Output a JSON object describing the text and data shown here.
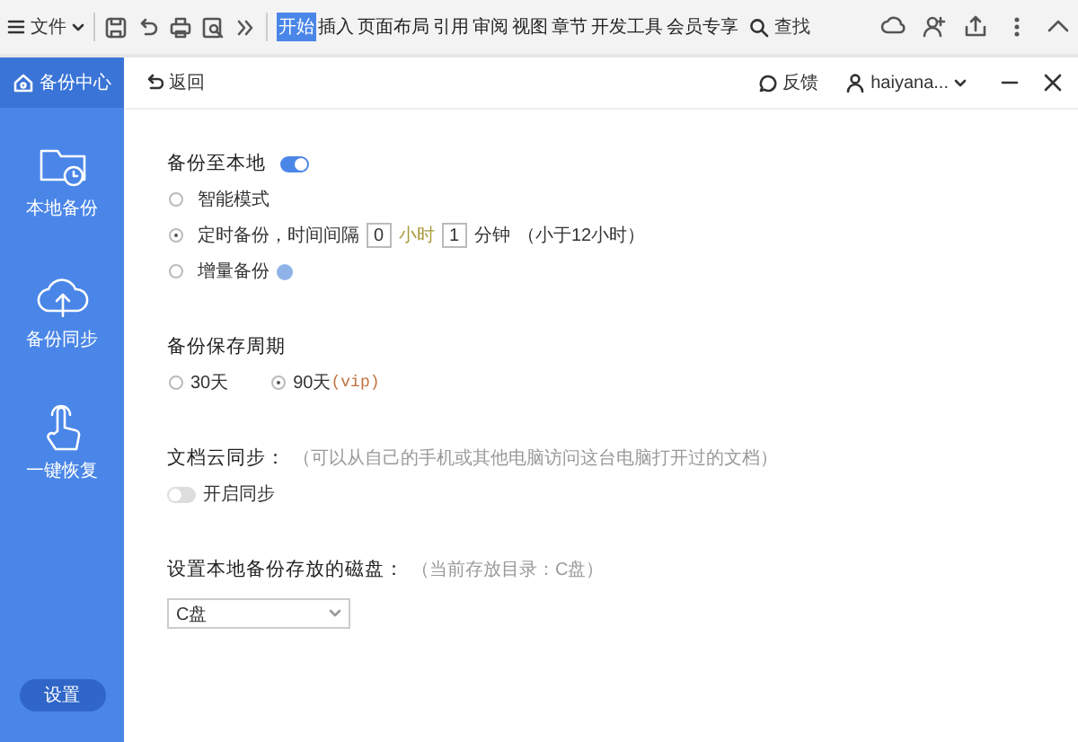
{
  "toolbar": {
    "menu_label": "文件",
    "tabs": [
      {
        "label": "开始",
        "selected": true
      },
      {
        "label": "插入",
        "selected": false
      },
      {
        "label": "页面布局",
        "selected": false
      },
      {
        "label": "引用",
        "selected": false
      },
      {
        "label": "审阅",
        "selected": false
      },
      {
        "label": "视图",
        "selected": false
      },
      {
        "label": "章节",
        "selected": false
      },
      {
        "label": "开发工具",
        "selected": false
      },
      {
        "label": "会员专享",
        "selected": false
      }
    ],
    "search": "查找"
  },
  "header": {
    "title": "备份中心",
    "back": "返回",
    "feedback": "反馈",
    "user": "haiyana..."
  },
  "sidebar": {
    "items": [
      {
        "kind": "folder",
        "label": "本地备份"
      },
      {
        "kind": "cloud",
        "label": "备份同步"
      },
      {
        "kind": "hand",
        "label": "一键恢复"
      }
    ],
    "settings": "设置"
  },
  "local_backup": {
    "label": "备份至本地",
    "on": true,
    "modes": [
      {
        "kind": "plain",
        "label": "智能模式",
        "selected": false
      },
      {
        "kind": "interval",
        "label": "定时备份，时间间隔",
        "hours": "0",
        "hours_unit": "小时",
        "minutes": "1",
        "minutes_unit": "分钟",
        "note": "（小于12小时）",
        "selected": true
      },
      {
        "kind": "help",
        "label": "增量备份",
        "selected": false
      }
    ]
  },
  "retention": {
    "label": "备份保存周期",
    "options": [
      {
        "label": "30天",
        "selected": false
      },
      {
        "label": "90天",
        "tag": "(vip)",
        "selected": true
      }
    ]
  },
  "cloud_sync": {
    "label": "文档云同步：",
    "hint": "（可以从自己的手机或其他电脑访问这台电脑打开过的文档）",
    "toggle_label": "开启同步",
    "on": false
  },
  "disk": {
    "label": "设置本地备份存放的磁盘：",
    "hint": "（当前存放目录：C盘）",
    "value": "C盘"
  }
}
